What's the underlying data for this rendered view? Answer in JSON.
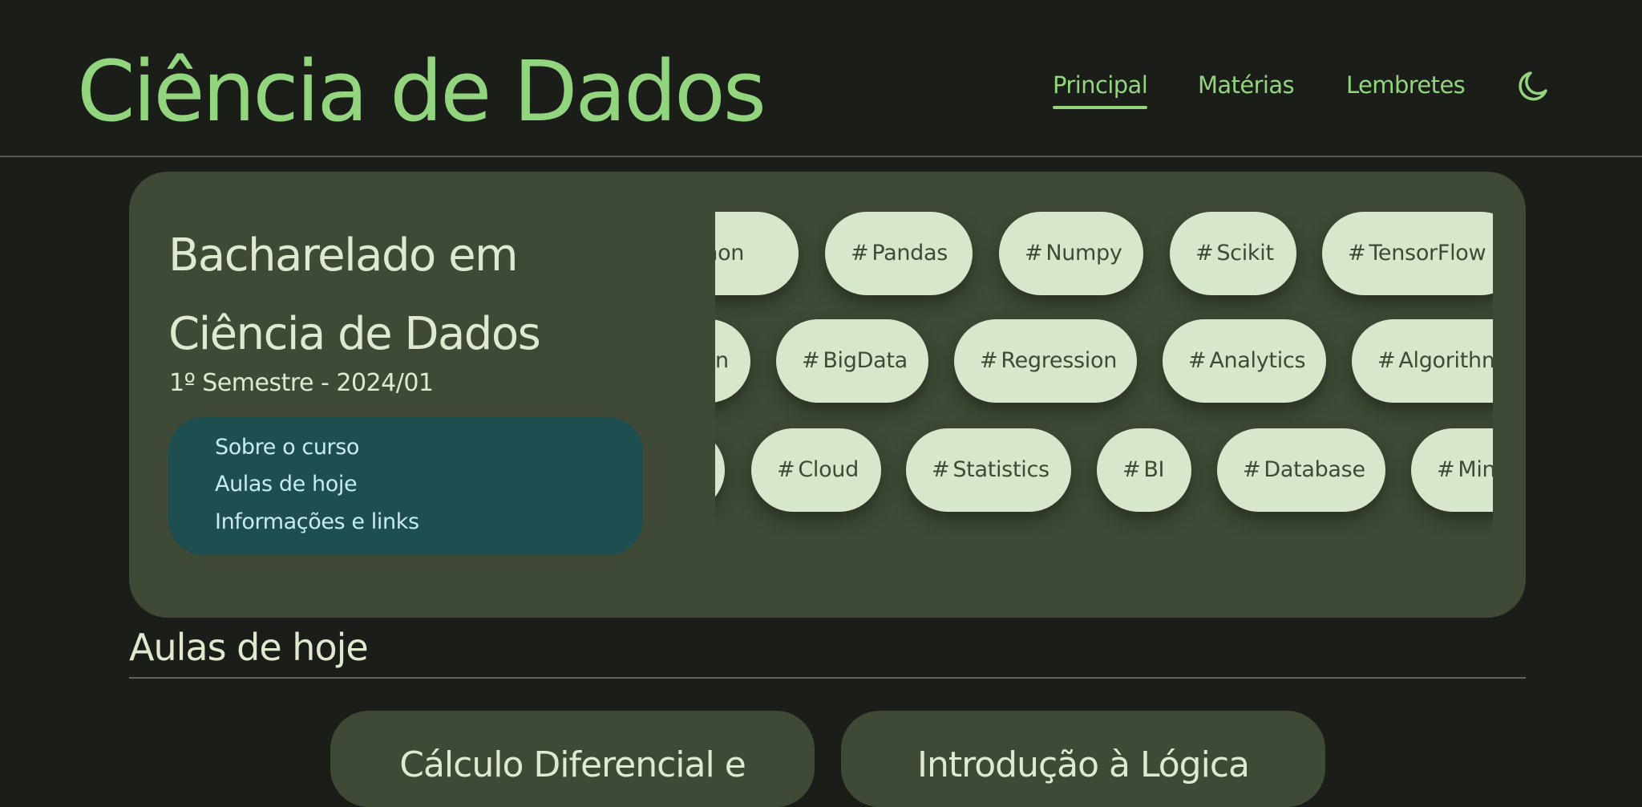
{
  "header": {
    "site_title": "Ciência de Dados",
    "nav": [
      {
        "label": "Principal",
        "active": true
      },
      {
        "label": "Matérias",
        "active": false
      },
      {
        "label": "Lembretes",
        "active": false
      }
    ],
    "theme_icon": "moon-icon"
  },
  "hero": {
    "title": "Bacharelado em Ciência de Dados",
    "subtitle": "1º Semestre - 2024/01",
    "menu": [
      "Sobre o curso",
      "Aulas de hoje",
      "Informações e links"
    ],
    "tag_prefix": "#",
    "tag_rows": [
      [
        "Python",
        "Pandas",
        "Numpy",
        "Scikit",
        "TensorFlow"
      ],
      [
        "n",
        "BigData",
        "Regression",
        "Analytics",
        "Algorithm"
      ],
      [
        "",
        "Cloud",
        "Statistics",
        "BI",
        "Database",
        "Min"
      ]
    ]
  },
  "today": {
    "section_title": "Aulas de hoje",
    "cards": [
      "Cálculo Diferencial e",
      "Introdução à Lógica"
    ]
  },
  "colors": {
    "background": "#1b1d19",
    "accent_green": "#93d57f",
    "card": "#3e4a35",
    "menu_panel": "#1f4e51",
    "tag_pill": "#d8e7cb"
  }
}
